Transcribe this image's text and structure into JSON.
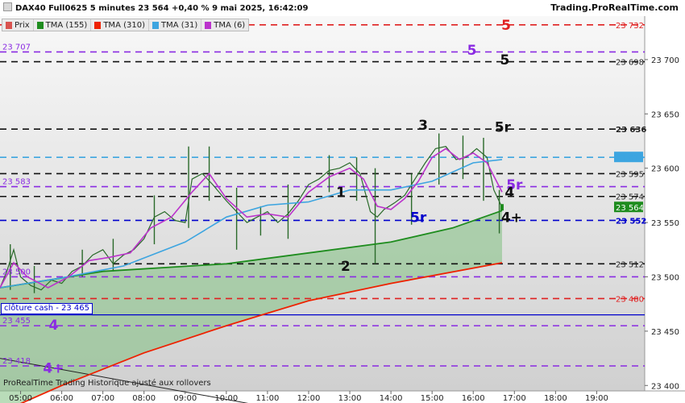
{
  "header": {
    "title": "DAX40 Full0625 5 minutes 23 564 +0,40 % 9 mai 2025, 16:42:09",
    "brand": "Trading.ProRealTime.com"
  },
  "legend": [
    {
      "label": "Prix",
      "color": "#d9534f"
    },
    {
      "label": "TMA (155)",
      "color": "#1e8c1e"
    },
    {
      "label": "TMA (310)",
      "color": "#ee2200"
    },
    {
      "label": "TMA (31)",
      "color": "#3da5e0"
    },
    {
      "label": "TMA (6)",
      "color": "#bb33cc"
    }
  ],
  "footer": "ProRealTime Trading  Historique ajusté aux rollovers",
  "cash_label": "clôture cash -  23 465",
  "chart_data": {
    "type": "candlestick",
    "ylim": [
      23395,
      23740
    ],
    "xlim": [
      "04:30",
      "20:10"
    ],
    "y_ticks": [
      "23 400",
      "23 450",
      "23 500",
      "23 550",
      "23 600",
      "23 650",
      "23 700"
    ],
    "x_ticks": [
      "05:00",
      "06:00",
      "07:00",
      "08:00",
      "09:00",
      "10:00",
      "11:00",
      "12:00",
      "13:00",
      "14:00",
      "15:00",
      "16:00",
      "17:00",
      "18:00",
      "19:00"
    ],
    "last_price": "23 564",
    "price_points": [
      [
        "04:30",
        23490
      ],
      [
        "04:40",
        23505
      ],
      [
        "04:50",
        23525
      ],
      [
        "05:00",
        23500
      ],
      [
        "05:15",
        23492
      ],
      [
        "05:30",
        23488
      ],
      [
        "05:45",
        23497
      ],
      [
        "06:00",
        23494
      ],
      [
        "06:15",
        23505
      ],
      [
        "06:30",
        23510
      ],
      [
        "06:45",
        23520
      ],
      [
        "07:00",
        23525
      ],
      [
        "07:15",
        23512
      ],
      [
        "07:30",
        23520
      ],
      [
        "07:45",
        23525
      ],
      [
        "08:00",
        23535
      ],
      [
        "08:15",
        23555
      ],
      [
        "08:30",
        23560
      ],
      [
        "08:45",
        23552
      ],
      [
        "09:00",
        23550
      ],
      [
        "09:10",
        23590
      ],
      [
        "09:25",
        23595
      ],
      [
        "09:40",
        23585
      ],
      [
        "10:00",
        23570
      ],
      [
        "10:15",
        23560
      ],
      [
        "10:30",
        23550
      ],
      [
        "10:45",
        23555
      ],
      [
        "11:00",
        23560
      ],
      [
        "11:15",
        23550
      ],
      [
        "11:30",
        23558
      ],
      [
        "11:45",
        23570
      ],
      [
        "12:00",
        23585
      ],
      [
        "12:15",
        23590
      ],
      [
        "12:30",
        23598
      ],
      [
        "12:45",
        23600
      ],
      [
        "13:00",
        23605
      ],
      [
        "13:15",
        23595
      ],
      [
        "13:30",
        23560
      ],
      [
        "13:40",
        23555
      ],
      [
        "13:50",
        23562
      ],
      [
        "14:05",
        23568
      ],
      [
        "14:20",
        23575
      ],
      [
        "14:35",
        23590
      ],
      [
        "14:50",
        23605
      ],
      [
        "15:05",
        23618
      ],
      [
        "15:20",
        23620
      ],
      [
        "15:35",
        23608
      ],
      [
        "15:50",
        23610
      ],
      [
        "16:05",
        23618
      ],
      [
        "16:20",
        23610
      ],
      [
        "16:30",
        23580
      ],
      [
        "16:42",
        23564
      ]
    ],
    "candles": [
      {
        "time": "04:45",
        "high": 23530,
        "low": 23488
      },
      {
        "time": "05:20",
        "high": 23510,
        "low": 23485
      },
      {
        "time": "06:30",
        "high": 23525,
        "low": 23500
      },
      {
        "time": "07:15",
        "high": 23535,
        "low": 23505
      },
      {
        "time": "08:15",
        "high": 23575,
        "low": 23530
      },
      {
        "time": "09:05",
        "high": 23620,
        "low": 23545
      },
      {
        "time": "09:35",
        "high": 23620,
        "low": 23570
      },
      {
        "time": "10:15",
        "high": 23582,
        "low": 23525
      },
      {
        "time": "10:50",
        "high": 23565,
        "low": 23538
      },
      {
        "time": "11:30",
        "high": 23585,
        "low": 23535
      },
      {
        "time": "12:30",
        "high": 23612,
        "low": 23578
      },
      {
        "time": "13:10",
        "high": 23610,
        "low": 23570
      },
      {
        "time": "13:37",
        "high": 23600,
        "low": 23512
      },
      {
        "time": "14:30",
        "high": 23595,
        "low": 23548
      },
      {
        "time": "15:10",
        "high": 23632,
        "low": 23585
      },
      {
        "time": "15:45",
        "high": 23630,
        "low": 23590
      },
      {
        "time": "16:15",
        "high": 23628,
        "low": 23570
      },
      {
        "time": "16:38",
        "high": 23580,
        "low": 23540
      }
    ],
    "series": [
      {
        "name": "TMA (155)",
        "color": "#1e8c1e",
        "points": [
          [
            "04:30",
            23490
          ],
          [
            "07:00",
            23505
          ],
          [
            "10:00",
            23512
          ],
          [
            "12:00",
            23522
          ],
          [
            "14:00",
            23532
          ],
          [
            "15:30",
            23545
          ],
          [
            "16:42",
            23561
          ]
        ]
      },
      {
        "name": "TMA (310)",
        "color": "#ee2200",
        "points": [
          [
            "04:30",
            23375
          ],
          [
            "06:00",
            23400
          ],
          [
            "08:00",
            23430
          ],
          [
            "10:00",
            23455
          ],
          [
            "12:00",
            23478
          ],
          [
            "14:00",
            23494
          ],
          [
            "16:42",
            23513
          ]
        ]
      },
      {
        "name": "TMA (31)",
        "color": "#3da5e0",
        "points": [
          [
            "04:30",
            23490
          ],
          [
            "06:00",
            23499
          ],
          [
            "07:30",
            23510
          ],
          [
            "09:00",
            23532
          ],
          [
            "10:00",
            23555
          ],
          [
            "11:00",
            23566
          ],
          [
            "12:00",
            23569
          ],
          [
            "13:00",
            23580
          ],
          [
            "14:00",
            23580
          ],
          [
            "15:00",
            23588
          ],
          [
            "16:00",
            23605
          ],
          [
            "16:42",
            23608
          ]
        ]
      },
      {
        "name": "TMA (6)",
        "color": "#bb33cc",
        "points": [
          [
            "04:30",
            23490
          ],
          [
            "04:50",
            23513
          ],
          [
            "05:10",
            23500
          ],
          [
            "05:40",
            23490
          ],
          [
            "06:10",
            23500
          ],
          [
            "06:40",
            23515
          ],
          [
            "07:10",
            23518
          ],
          [
            "07:40",
            23522
          ],
          [
            "08:10",
            23545
          ],
          [
            "08:40",
            23555
          ],
          [
            "09:10",
            23578
          ],
          [
            "09:35",
            23595
          ],
          [
            "10:00",
            23572
          ],
          [
            "10:30",
            23555
          ],
          [
            "11:00",
            23558
          ],
          [
            "11:30",
            23555
          ],
          [
            "12:00",
            23578
          ],
          [
            "12:30",
            23592
          ],
          [
            "13:00",
            23600
          ],
          [
            "13:20",
            23590
          ],
          [
            "13:40",
            23565
          ],
          [
            "14:00",
            23562
          ],
          [
            "14:20",
            23572
          ],
          [
            "14:40",
            23588
          ],
          [
            "15:00",
            23610
          ],
          [
            "15:20",
            23618
          ],
          [
            "15:40",
            23608
          ],
          [
            "16:00",
            23614
          ],
          [
            "16:20",
            23605
          ],
          [
            "16:42",
            23578
          ]
        ]
      }
    ],
    "trendline": {
      "color": "#222222",
      "points": [
        [
          "04:30",
          23425
        ],
        [
          "11:20",
          23378
        ]
      ]
    },
    "levels": [
      {
        "value": 23732,
        "label": "23 732",
        "color": "#e02020",
        "style": "dashed"
      },
      {
        "value": 23707,
        "label": "23 707",
        "color": "#8a2be2",
        "style": "dashed"
      },
      {
        "value": 23698,
        "label": "23 698",
        "color": "#111111",
        "style": "dashed"
      },
      {
        "value": 23636,
        "label": "23 636",
        "color": "#111111",
        "style": "dashed"
      },
      {
        "value": 23610,
        "label": "23 610",
        "color": "#3da5e0",
        "style": "dashed"
      },
      {
        "value": 23595,
        "label": "23 595",
        "color": "#111111",
        "style": "dashed"
      },
      {
        "value": 23583,
        "label": "23 583",
        "color": "#8a2be2",
        "style": "dashed"
      },
      {
        "value": 23574,
        "label": "23 574",
        "color": "#111111",
        "style": "dashed"
      },
      {
        "value": 23564,
        "label": "23 564",
        "color": "#1e8c1e",
        "style": "none"
      },
      {
        "value": 23552,
        "label": "23 552",
        "color": "#0000cc",
        "style": "dashed"
      },
      {
        "value": 23512,
        "label": "23 512",
        "color": "#111111",
        "style": "dashed"
      },
      {
        "value": 23500,
        "label": "23 500",
        "color": "#8a2be2",
        "style": "dashed"
      },
      {
        "value": 23480,
        "label": "23 480",
        "color": "#e02020",
        "style": "dashed"
      },
      {
        "value": 23465,
        "label": "",
        "color": "#0000cc",
        "style": "solid"
      },
      {
        "value": 23455,
        "label": "23 455",
        "color": "#8a2be2",
        "style": "dashed"
      },
      {
        "value": 23418,
        "label": "23 418",
        "color": "#8a2be2",
        "style": "dashed"
      }
    ],
    "annotations": [
      {
        "text": "5",
        "time": "16:48",
        "value": 23732,
        "color": "#e02020"
      },
      {
        "text": "5",
        "time": "15:58",
        "value": 23709,
        "color": "#8a2be2"
      },
      {
        "text": "5",
        "time": "16:46",
        "value": 23700,
        "color": "#111111"
      },
      {
        "text": "3",
        "time": "14:47",
        "value": 23640,
        "color": "#111111"
      },
      {
        "text": "5r",
        "time": "16:43",
        "value": 23638,
        "color": "#111111"
      },
      {
        "text": "5r",
        "time": "17:00",
        "value": 23585,
        "color": "#8a2be2"
      },
      {
        "text": "1",
        "time": "12:47",
        "value": 23578,
        "color": "#111111"
      },
      {
        "text": "4",
        "time": "16:53",
        "value": 23578,
        "color": "#111111"
      },
      {
        "text": "5r",
        "time": "14:40",
        "value": 23555,
        "color": "#0000cc"
      },
      {
        "text": "4+",
        "time": "16:56",
        "value": 23555,
        "color": "#111111"
      },
      {
        "text": "2",
        "time": "12:54",
        "value": 23510,
        "color": "#111111"
      },
      {
        "text": "4",
        "time": "05:48",
        "value": 23456,
        "color": "#8a2be2"
      },
      {
        "text": "4+",
        "time": "05:48",
        "value": 23416,
        "color": "#8a2be2"
      }
    ]
  }
}
